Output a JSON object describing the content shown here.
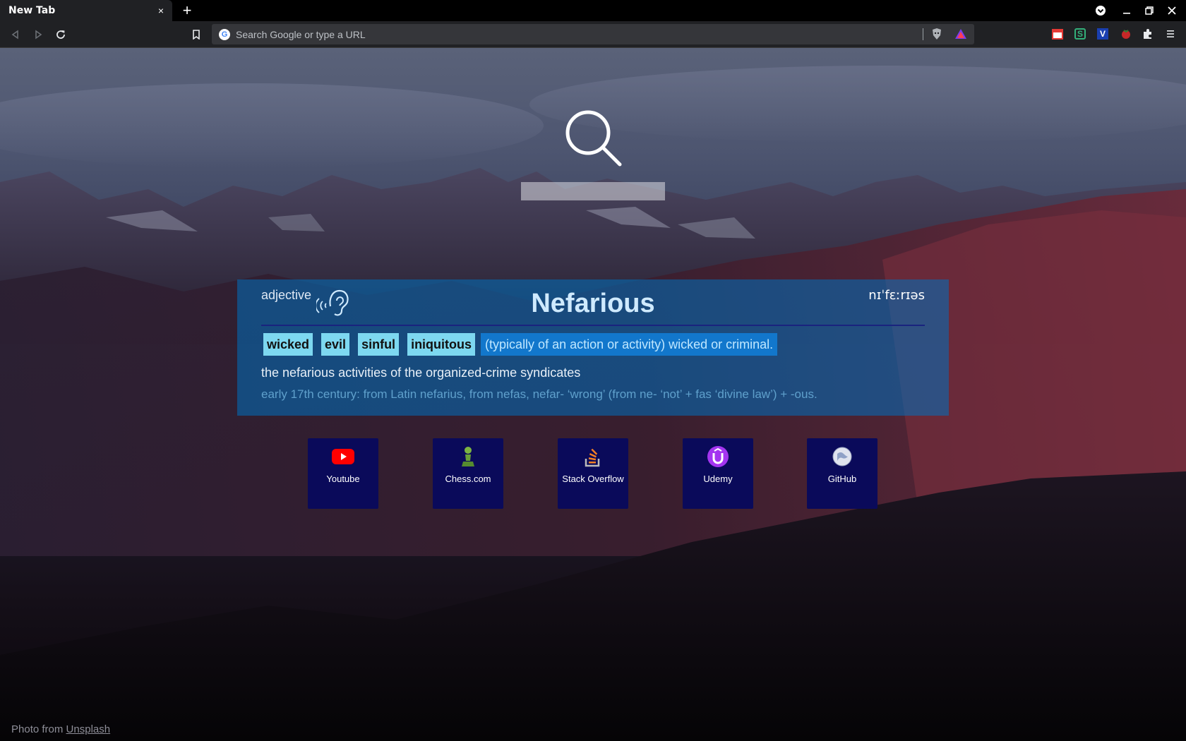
{
  "tab": {
    "title": "New Tab",
    "close": "×",
    "new_tab": "+"
  },
  "omnibox": {
    "placeholder": "Search Google or type a URL",
    "g_letter": "G"
  },
  "extensions": {
    "calendar_badge": "16",
    "s_letter": "S",
    "v_letter": "V"
  },
  "word_card": {
    "part_of_speech": "adjective",
    "word": "Nefarious",
    "phonetic": "nɪˈfɛːrɪəs",
    "synonyms": [
      "wicked",
      "evil",
      "sinful",
      "iniquitous"
    ],
    "definition": "(typically of an action or activity) wicked or criminal.",
    "example": "the nefarious activities of the organized-crime syndicates",
    "origin": "early 17th century: from Latin nefarius, from nefas, nefar- ‘wrong’ (from ne- ‘not’ + fas ‘divine law’) + -ous."
  },
  "shortcuts": [
    {
      "label": "Youtube",
      "icon": "youtube-icon"
    },
    {
      "label": "Chess.com",
      "icon": "chess-pawn-icon"
    },
    {
      "label": "Stack Overflow",
      "icon": "stackoverflow-icon"
    },
    {
      "label": "Udemy",
      "icon": "udemy-icon"
    },
    {
      "label": "GitHub",
      "icon": "globe-icon"
    }
  ],
  "credit": {
    "prefix": "Photo from ",
    "link": "Unsplash"
  },
  "colors": {
    "card": "#0070be",
    "synonym_bg": "#7dd8f0",
    "shortcut_bg": "#0a0a5a",
    "word": "#cfeaff"
  }
}
